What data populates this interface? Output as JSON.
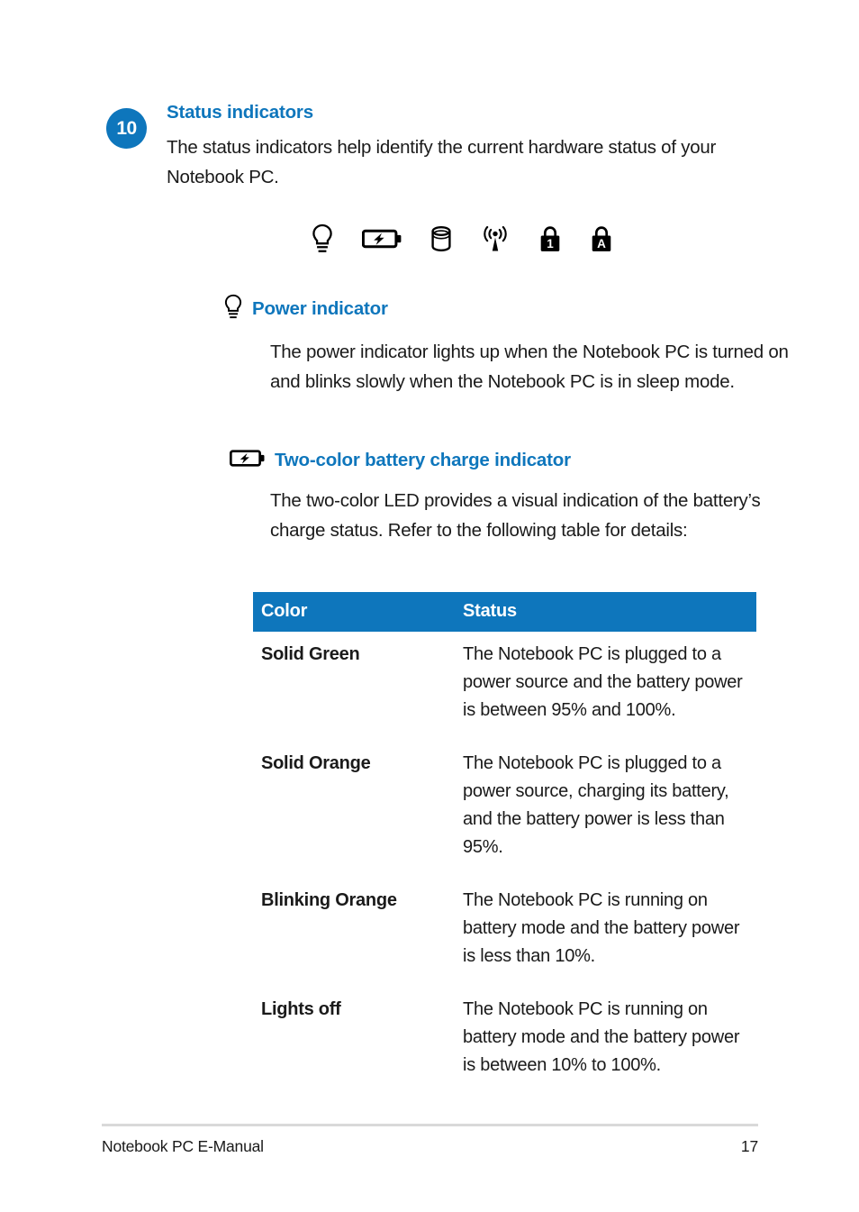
{
  "step": {
    "number": "10",
    "title": "Status indicators",
    "description": "The status indicators help identify the current hardware status of your Notebook PC."
  },
  "icon_strip": {
    "icons": [
      {
        "name": "power-indicator-icon",
        "label": "Power indicator"
      },
      {
        "name": "two-color-battery-charge-icon",
        "label": "Two-color battery charge indicator"
      },
      {
        "name": "drive-activity-icon",
        "label": "Drive activity indicator"
      },
      {
        "name": "wireless-bluetooth-icon",
        "label": "Wireless / Bluetooth indicator"
      },
      {
        "name": "number-lock-icon",
        "label": "Number lock indicator"
      },
      {
        "name": "capital-lock-icon",
        "label": "Capital lock indicator"
      }
    ]
  },
  "sections": [
    {
      "icon": "power-indicator-icon",
      "title": "Power indicator",
      "text": "The power indicator lights up when the Notebook PC is turned on and blinks slowly when the Notebook PC is in sleep mode."
    },
    {
      "icon": "two-color-battery-charge-icon",
      "title": "Two-color battery charge indicator",
      "text": "The two-color LED provides a visual indication of the battery’s charge status. Refer to the following table for details:"
    }
  ],
  "table": {
    "headers": [
      "Color",
      "Status"
    ],
    "rows": [
      {
        "color": "Solid Green",
        "status": "The Notebook PC is plugged to a power source and the battery power is between 95% and 100%."
      },
      {
        "color": "Solid Orange",
        "status": "The Notebook PC is plugged to a power source, charging its battery, and the battery power is less than 95%."
      },
      {
        "color": "Blinking Orange",
        "status": "The Notebook PC is running on battery mode and the battery power is less than 10%."
      },
      {
        "color": "Lights off",
        "status": "The  Notebook PC is running on battery mode and the battery power is between 10% to 100%."
      }
    ]
  },
  "footer": {
    "manual_title": "Notebook PC E-Manual",
    "page_number": "17"
  },
  "colors": {
    "accent_blue": "#0e76bc",
    "text": "#1a1a1a",
    "rule": "#d9d9d9"
  }
}
